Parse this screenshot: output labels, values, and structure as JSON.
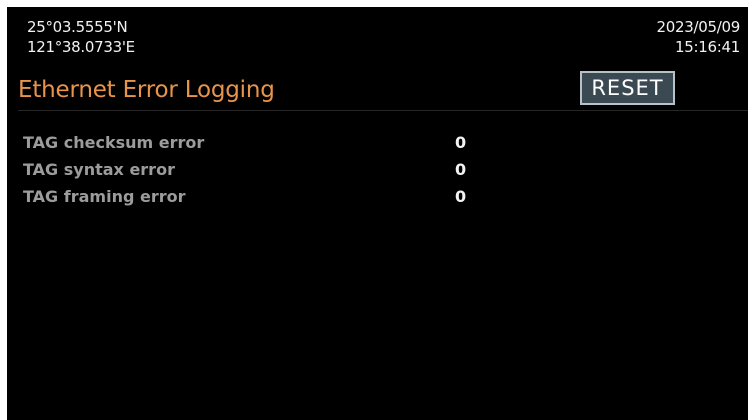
{
  "header": {
    "latitude": "25°03.5555'N",
    "longitude": "121°38.0733'E",
    "date": "2023/05/09",
    "time": "15:16:41"
  },
  "page": {
    "title": "Ethernet Error Logging",
    "reset_label": "RESET"
  },
  "errors": [
    {
      "label": "TAG checksum error",
      "value": "0"
    },
    {
      "label": "TAG syntax error",
      "value": "0"
    },
    {
      "label": "TAG framing error",
      "value": "0"
    }
  ],
  "colors": {
    "title": "#e8944a",
    "background": "#000000",
    "label": "#9c9c9c",
    "button_bg": "#3b4a52",
    "button_border": "#b7c2c6"
  }
}
